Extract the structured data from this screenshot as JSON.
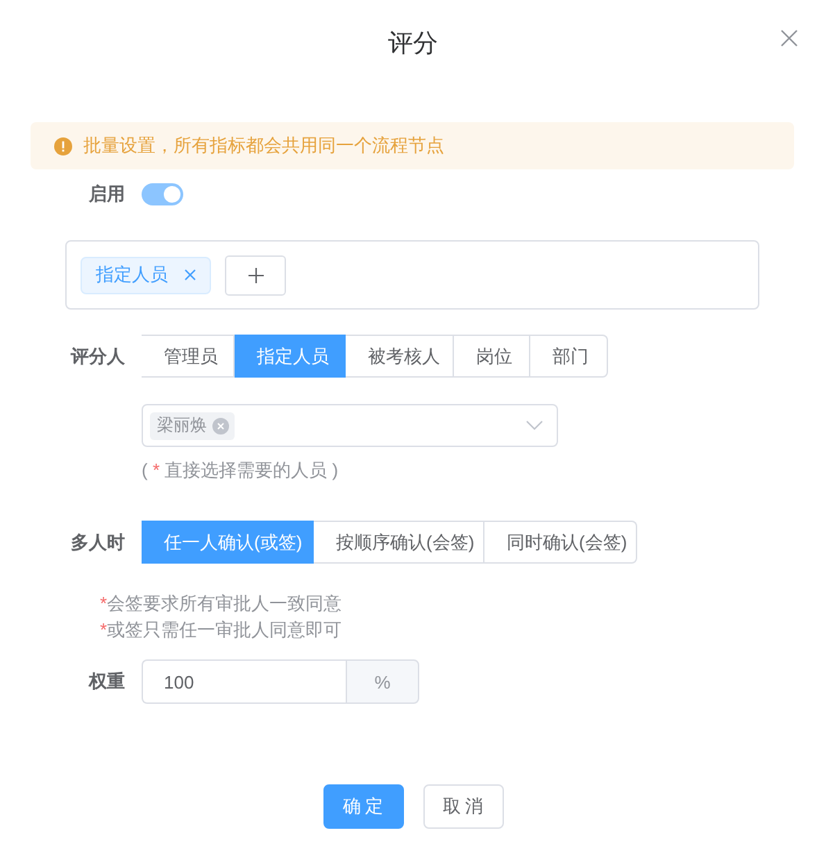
{
  "dialog": {
    "title": "评分"
  },
  "alert": {
    "text": "批量设置，所有指标都会共用同一个流程节点"
  },
  "enable": {
    "label": "启用",
    "on": true
  },
  "node_tags": [
    {
      "label": "指定人员"
    }
  ],
  "raters": {
    "label": "评分人",
    "options": [
      {
        "label": "管理员",
        "selected": false
      },
      {
        "label": "指定人员",
        "selected": true
      },
      {
        "label": "被考核人",
        "selected": false
      },
      {
        "label": "岗位",
        "selected": false
      },
      {
        "label": "部门",
        "selected": false
      }
    ]
  },
  "person_select": {
    "tags": [
      {
        "label": "梁丽焕"
      }
    ]
  },
  "hint": {
    "open": "(",
    "mark": "*",
    "text": "直接选择需要的人员",
    "close": ")"
  },
  "multi": {
    "label": "多人时",
    "options": [
      {
        "label": "任一人确认(或签)",
        "selected": true
      },
      {
        "label": "按顺序确认(会签)",
        "selected": false
      },
      {
        "label": "同时确认(会签)",
        "selected": false
      }
    ]
  },
  "notes": [
    {
      "mark": "*",
      "text": "会签要求所有审批人一致同意"
    },
    {
      "mark": "*",
      "text": "或签只需任一审批人同意即可"
    }
  ],
  "weight": {
    "label": "权重",
    "value": "100",
    "suffix": "%"
  },
  "buttons": [
    {
      "label": "确定",
      "kind": "primary"
    },
    {
      "label": "取消",
      "kind": "default"
    }
  ]
}
